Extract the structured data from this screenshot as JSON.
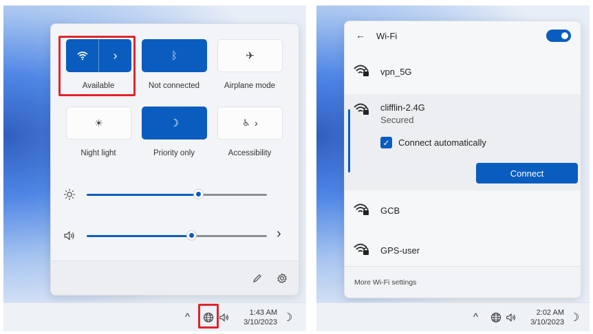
{
  "left": {
    "tiles": {
      "wifi": {
        "label": "Available",
        "glyph": "ᯤ",
        "arrow": "›"
      },
      "bluetooth": {
        "label": "Not connected",
        "glyph": "ᛒ"
      },
      "airplane": {
        "label": "Airplane mode",
        "glyph": "✈"
      },
      "night_light": {
        "label": "Night light",
        "glyph": "☀"
      },
      "focus": {
        "label": "Priority only",
        "glyph": "☽"
      },
      "accessibility": {
        "label": "Accessibility",
        "glyph": "♿",
        "arrow": "›"
      }
    },
    "brightness": {
      "icon": "brightness-icon",
      "level": 0.62
    },
    "volume": {
      "icon": "speaker-icon",
      "level": 0.58,
      "arrow": "›"
    },
    "footer": {
      "edit_icon": "pencil-icon",
      "settings_icon": "gear-icon"
    },
    "taskbar": {
      "chevron": "^",
      "time": "1:43 AM",
      "date": "3/10/2023",
      "focus_glyph": "☽"
    },
    "highlight_color": "#e0242a"
  },
  "right": {
    "header": {
      "back": "←",
      "title": "Wi-Fi",
      "toggle_on": true
    },
    "networks": [
      {
        "name": "vpn_5G"
      },
      {
        "name": "clifflin-2.4G",
        "status": "Secured",
        "checkbox_label": "Connect automatically",
        "connect_label": "Connect"
      },
      {
        "name": "GCB"
      },
      {
        "name": "GPS-user"
      }
    ],
    "footer": {
      "more_label": "More Wi-Fi settings"
    },
    "taskbar": {
      "chevron": "^",
      "time": "2:02 AM",
      "date": "3/10/2023",
      "focus_glyph": "☽"
    }
  },
  "colors": {
    "accent": "#0a5dbf",
    "panel": "#f3f4f7"
  }
}
